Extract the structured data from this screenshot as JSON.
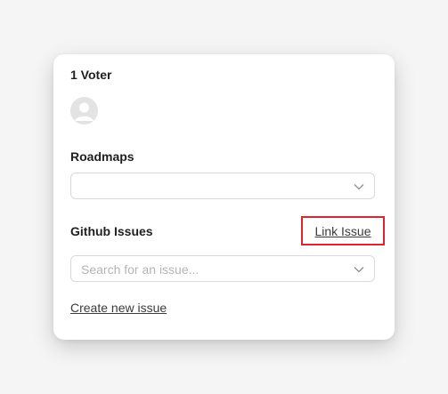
{
  "voters": {
    "title": "1 Voter",
    "avatar_icon": "user-avatar-placeholder-icon"
  },
  "roadmaps": {
    "label": "Roadmaps",
    "selected_value": "",
    "chevron_icon": "chevron-down-icon"
  },
  "github_issues": {
    "label": "Github Issues",
    "link_issue_label": "Link Issue",
    "search_placeholder": "Search for an issue...",
    "chevron_icon": "chevron-down-icon",
    "create_new_issue_label": "Create new issue"
  },
  "colors": {
    "highlight_border": "#e0242f",
    "text_primary": "#1f1f1f",
    "placeholder": "#b5b5b5"
  }
}
